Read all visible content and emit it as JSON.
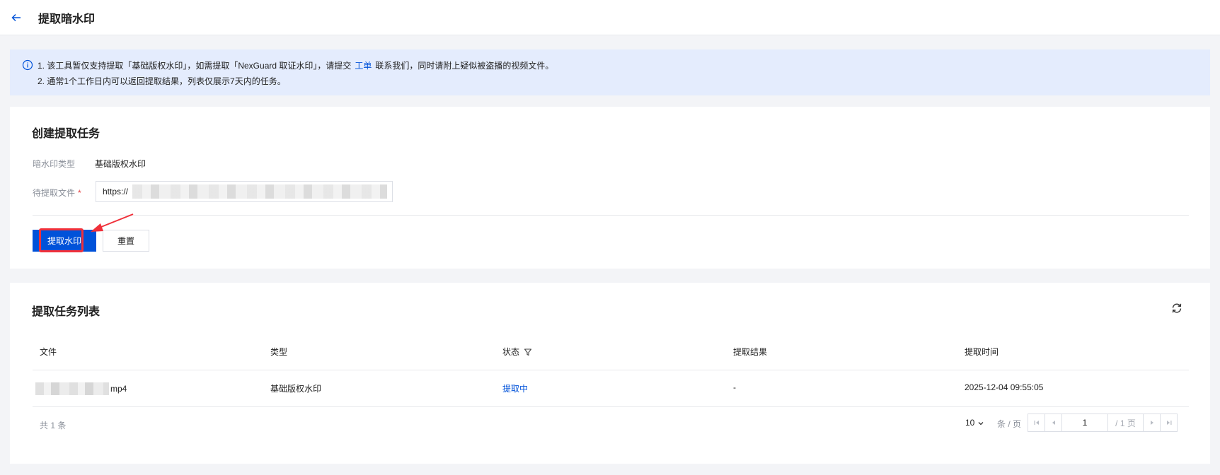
{
  "header": {
    "title": "提取暗水印"
  },
  "notice": {
    "line1_before": "1. 该工具暂仅支持提取「基础版权水印」，如需提取「NexGuard 取证水印」，请提交",
    "line1_link": "工单",
    "line1_after": "联系我们，同时请附上疑似被盗播的视频文件。",
    "line2": "2. 通常1个工作日内可以返回提取结果，列表仅展示7天内的任务。"
  },
  "create_task": {
    "title": "创建提取任务",
    "type_label": "暗水印类型",
    "type_value": "基础版权水印",
    "file_label": "待提取文件",
    "required_mark": "*",
    "file_value": "https://",
    "submit_label": "提取水印",
    "reset_label": "重置"
  },
  "task_list": {
    "title": "提取任务列表",
    "columns": [
      "文件",
      "类型",
      "状态",
      "提取结果",
      "提取时间"
    ],
    "rows": [
      {
        "file": "mp4",
        "type": "基础版权水印",
        "status": "提取中",
        "result": "-",
        "time": "2025-12-04 09:55:05"
      }
    ],
    "total": "共 1 条",
    "page_size": "10",
    "page_unit": "条 / 页",
    "current_page": "1",
    "page_total": "/ 1 页"
  },
  "colors": {
    "primary": "#0052d9",
    "notice_bg": "#e4ecfd",
    "annotation": "#f0303a"
  }
}
